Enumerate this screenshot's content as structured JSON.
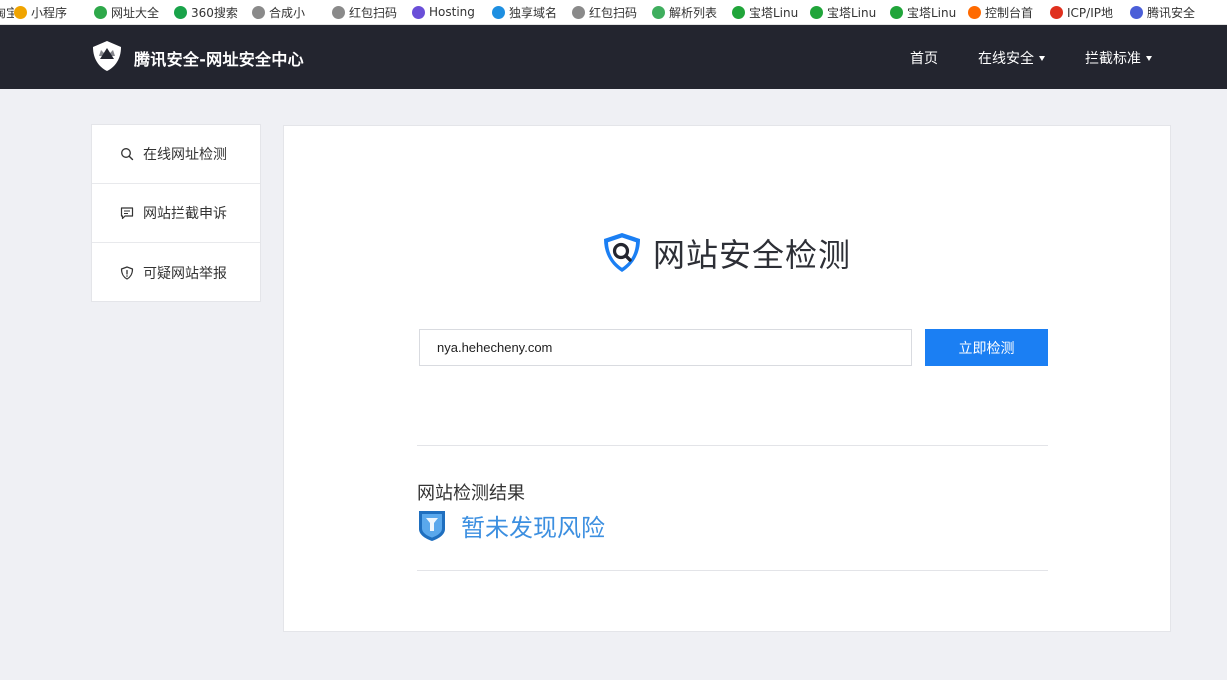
{
  "bookmarks": [
    {
      "label": "淘宝",
      "icon": "taobao-icon",
      "color": "#ff6a00"
    },
    {
      "label": "小程序",
      "icon": "miniapp-icon",
      "color": "#f0a400"
    },
    {
      "label": "网址大全",
      "icon": "sites-icon",
      "color": "#2ea84a"
    },
    {
      "label": "360搜索",
      "icon": "search360-icon",
      "color": "#19a34a"
    },
    {
      "label": "合成小",
      "icon": "globe-icon",
      "color": "#8a8a8a"
    },
    {
      "label": "红包扫码",
      "icon": "globe-icon",
      "color": "#8a8a8a"
    },
    {
      "label": "Hosting",
      "icon": "hosting-icon",
      "color": "#6a4fd8"
    },
    {
      "label": "独享域名",
      "icon": "domain-icon",
      "color": "#1e8fe1"
    },
    {
      "label": "红包扫码",
      "icon": "globe-icon",
      "color": "#8a8a8a"
    },
    {
      "label": "解析列表",
      "icon": "leaf-icon",
      "color": "#3fae5e"
    },
    {
      "label": "宝塔Linu",
      "icon": "bt-icon",
      "color": "#20a53a"
    },
    {
      "label": "宝塔Linu",
      "icon": "bt-icon",
      "color": "#20a53a"
    },
    {
      "label": "宝塔Linu",
      "icon": "bt-icon",
      "color": "#20a53a"
    },
    {
      "label": "控制台首",
      "icon": "aliyun-icon",
      "color": "#ff6a00"
    },
    {
      "label": "ICP/IP地",
      "icon": "icp-icon",
      "color": "#e0301e"
    },
    {
      "label": "腾讯安全",
      "icon": "tencent-shield-icon",
      "color": "#4b5fd8"
    }
  ],
  "header": {
    "brand": "腾讯安全-网址安全中心",
    "nav": [
      {
        "label": "首页",
        "has_dropdown": false
      },
      {
        "label": "在线安全",
        "has_dropdown": true
      },
      {
        "label": "拦截标准",
        "has_dropdown": true
      }
    ]
  },
  "sidebar": {
    "items": [
      {
        "label": "在线网址检测",
        "icon": "search-icon"
      },
      {
        "label": "网站拦截申诉",
        "icon": "message-icon"
      },
      {
        "label": "可疑网站举报",
        "icon": "shield-alert-icon"
      }
    ]
  },
  "main": {
    "title": "网站安全检测",
    "url_value": "nya.hehecheny.com",
    "check_button": "立即检测",
    "result_label": "网站检测结果",
    "result_text": "暂未发现风险"
  },
  "colors": {
    "nav_bg": "#23252f",
    "accent": "#1b7ff3",
    "result_blue": "#3c8fe0",
    "page_bg": "#eff0f4"
  }
}
